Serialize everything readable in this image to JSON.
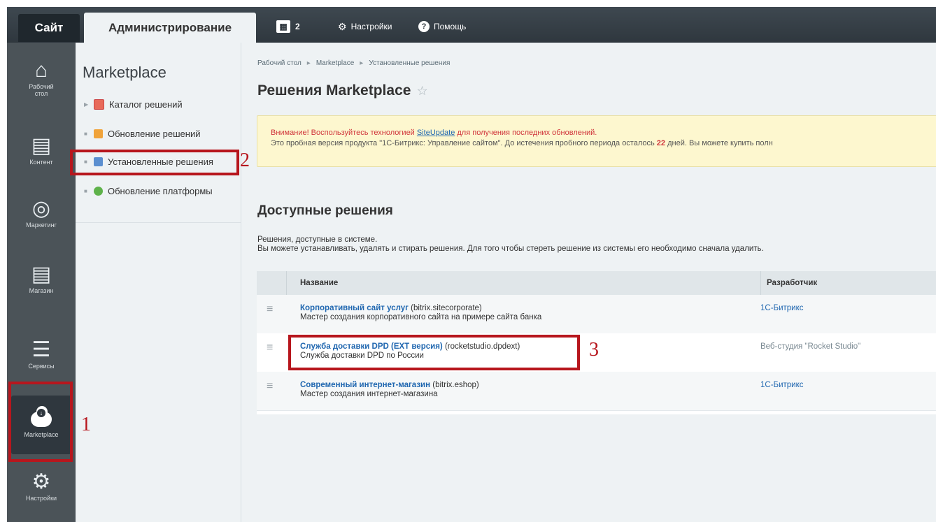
{
  "topbar": {
    "tab_site": "Сайт",
    "tab_admin": "Администрирование",
    "notifications_count": "2",
    "settings_label": "Настройки",
    "help_label": "Помощь"
  },
  "iconbar": {
    "items": [
      {
        "label": "Рабочий стол",
        "icon": "home-icon"
      },
      {
        "label": "Контент",
        "icon": "document-icon"
      },
      {
        "label": "Маркетинг",
        "icon": "target-icon"
      },
      {
        "label": "Магазин",
        "icon": "basket-icon"
      },
      {
        "label": "Сервисы",
        "icon": "layers-icon"
      },
      {
        "label": "Marketplace",
        "icon": "cloud-download-icon"
      },
      {
        "label": "Настройки",
        "icon": "gear-icon"
      }
    ]
  },
  "submenu": {
    "title": "Marketplace",
    "items": [
      {
        "label": "Каталог решений"
      },
      {
        "label": "Обновление решений"
      },
      {
        "label": "Установленные решения"
      },
      {
        "label": "Обновление платформы"
      }
    ]
  },
  "breadcrumbs": [
    "Рабочий стол",
    "Marketplace",
    "Установленные решения"
  ],
  "page_title": "Решения Marketplace",
  "notice": {
    "line1_before": "Внимание! Воспользуйтесь технологией ",
    "line1_link": "SiteUpdate",
    "line1_after": " для получения последних обновлений.",
    "line2_before": "Это пробная версия продукта \"1С-Битрикс: Управление сайтом\". До истечения пробного периода осталось ",
    "line2_days": "22",
    "line2_after": " дней. Вы можете купить полн"
  },
  "section": {
    "title": "Доступные решения",
    "desc1": "Решения, доступные в системе.",
    "desc2": "Вы можете устанавливать, удалять и стирать решения. Для того чтобы стереть решение из системы его необходимо сначала удалить."
  },
  "table": {
    "headers": {
      "name": "Название",
      "developer": "Разработчик"
    },
    "rows": [
      {
        "name": "Корпоративный сайт услуг",
        "code": " (bitrix.sitecorporate)",
        "desc": "Мастер создания корпоративного сайта на примере сайта банка",
        "developer": "1С-Битрикс"
      },
      {
        "name": "Служба доставки DPD (EXT версия)",
        "code": " (rocketstudio.dpdext)",
        "desc": "Служба доставки DPD по России",
        "developer": "Веб-студия \"Rocket Studio\""
      },
      {
        "name": "Современный интернет-магазин",
        "code": " (bitrix.eshop)",
        "desc": "Мастер создания интернет-магазина",
        "developer": "1С-Битрикс"
      }
    ]
  },
  "annotations": [
    "1",
    "2",
    "3"
  ],
  "colors": {
    "accent_red": "#b7161d",
    "link_blue": "#2067b0",
    "sidebar": "#4b5358"
  }
}
